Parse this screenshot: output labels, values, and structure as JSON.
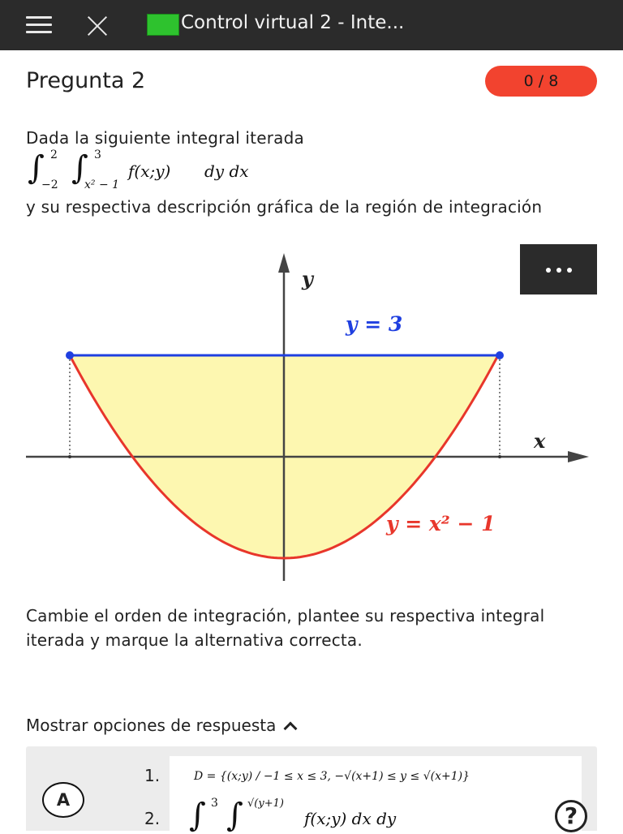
{
  "header": {
    "title": "Control virtual 2 - Inte..."
  },
  "question": {
    "title": "Pregunta 2",
    "score": "0 / 8"
  },
  "body": {
    "intro": "Dada la siguiente integral iterada",
    "integral": {
      "outer_upper": "2",
      "outer_lower": "−2",
      "inner_upper": "3",
      "inner_lower": "x² − 1",
      "integrand": "f(x;y)",
      "differentials": "dy dx"
    },
    "description": "y su respectiva descripción gráfica de la región de integración",
    "instruction": "Cambie el orden de integración, plantee su respectiva integral iterada y marque la alternativa correcta."
  },
  "graph": {
    "y_axis_label": "y",
    "x_axis_label": "x",
    "upper_label": "y = 3",
    "lower_label": "y = x² − 1",
    "upper_color": "#1f3fe0",
    "lower_color": "#e8362b",
    "fill_color": "#fdf7b0"
  },
  "options": {
    "toggle_label": "Mostrar opciones de respuesta",
    "first": {
      "letter": "A",
      "line1_number": "1.",
      "line1_text": "D = {(x;y) / −1 ≤ x ≤ 3, −√(x+1) ≤ y ≤ √(x+1)}",
      "line2_number": "2.",
      "line2_integrand": "f(x;y) dx dy",
      "line2_upper": "3",
      "line2_inner_upper": "√(y+1)"
    }
  },
  "icons": {
    "menu": "hamburger-icon",
    "close": "close-icon",
    "more": "more-icon",
    "help": "help-icon",
    "chevron": "chevron-up-icon"
  }
}
